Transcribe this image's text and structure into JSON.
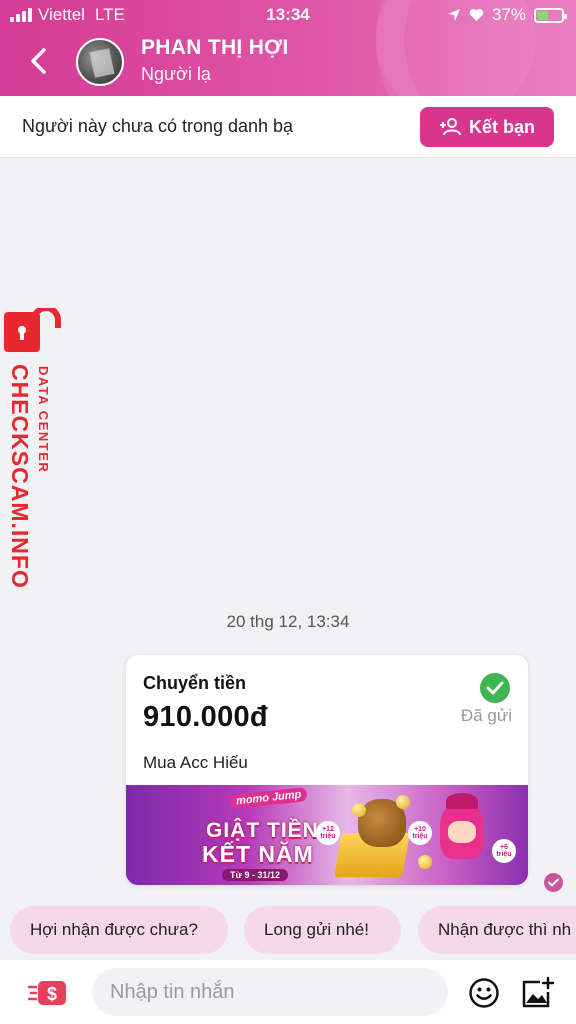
{
  "status": {
    "carrier": "Viettel",
    "network": "LTE",
    "time": "13:34",
    "battery": "37%"
  },
  "header": {
    "name": "PHAN THỊ HỢI",
    "subtitle": "Người lạ"
  },
  "contact_bar": {
    "message": "Người này chưa có trong danh bạ",
    "add_button": "Kết bạn"
  },
  "watermark": {
    "main": "CHECKSCAM.INFO",
    "sub": "DATA CENTER"
  },
  "timestamp": "20 thg 12, 13:34",
  "transfer": {
    "title": "Chuyển tiền",
    "amount": "910.000đ",
    "status": "Đã gửi",
    "note": "Mua Acc Hiếu",
    "banner": {
      "brand": "momo Jump",
      "line1": "GIẬT TIỀN",
      "line2": "KẾT NĂM",
      "dates": "Từ 9 - 31/12",
      "bubble1": "+12 triệu",
      "bubble2": "+10 triệu",
      "bubble3": "+6 triệu"
    }
  },
  "quick_replies": [
    "Hợi nhận được chưa?",
    "Long gửi nhé!",
    "Nhận được thì nh"
  ],
  "composer": {
    "placeholder": "Nhập tin nhắn"
  },
  "colors": {
    "brand": "#d8368e",
    "check": "#3fb651",
    "chip": "#f6d9e7",
    "watermark": "#e8272e"
  },
  "icons": [
    "back-arrow-icon",
    "add-friend-icon",
    "lock-icon",
    "check-icon",
    "send-money-icon",
    "emoji-icon",
    "add-image-icon"
  ]
}
